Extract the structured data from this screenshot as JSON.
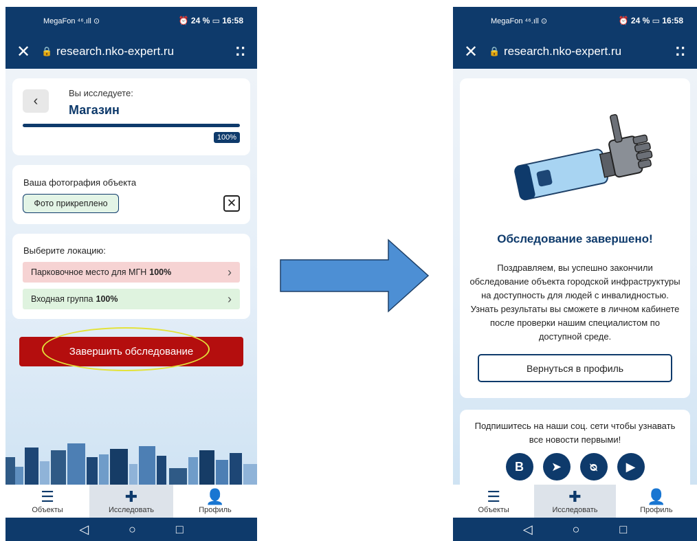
{
  "status_bar": {
    "carrier": "MegaFon ⁴⁶.ıll ⊙",
    "battery": "24 %",
    "time": "16:58"
  },
  "browser": {
    "url": "research.nko-expert.ru"
  },
  "left_screen": {
    "you_explore_label": "Вы исследуете:",
    "object_name": "Магазин",
    "progress": 1.0,
    "progress_label": "100%",
    "photo_section_title": "Ваша фотография объекта",
    "photo_status": "Фото прикреплено",
    "location_section_title": "Выберите локацию:",
    "locations": [
      {
        "name": "Парковочное место для МГН",
        "percent": "100%",
        "color": "#f6d3d3"
      },
      {
        "name": "Входная группа",
        "percent": "100%",
        "color": "#dff3df"
      }
    ],
    "finish_button": "Завершить обследование"
  },
  "right_screen": {
    "title": "Обследование завершено!",
    "message": "Поздравляем, вы успешно закончили обследование объекта городской инфраструктуры на доступность для людей с инвалидностью. Узнать результаты вы сможете в личном кабинете после проверки нашим специалистом по доступной среде.",
    "return_button": "Вернуться в профиль",
    "social_text": "Подпишитесь на наши соц. сети чтобы узнавать все новости первыми!",
    "social_icons": [
      {
        "name": "vk-icon",
        "glyph": "В"
      },
      {
        "name": "telegram-icon",
        "glyph": "➤"
      },
      {
        "name": "odnoklassniki-icon",
        "glyph": "ᴓ"
      },
      {
        "name": "youtube-icon",
        "glyph": "▶"
      }
    ]
  },
  "nav": {
    "items": [
      {
        "label": "Объекты",
        "icon": "list-icon"
      },
      {
        "label": "Исследовать",
        "icon": "plus-icon"
      },
      {
        "label": "Профиль",
        "icon": "user-icon"
      }
    ]
  },
  "colors": {
    "brand": "#0e3a6b",
    "danger": "#b40e0e",
    "arrow": "#4d8fd4",
    "highlight": "#e3e23a"
  }
}
